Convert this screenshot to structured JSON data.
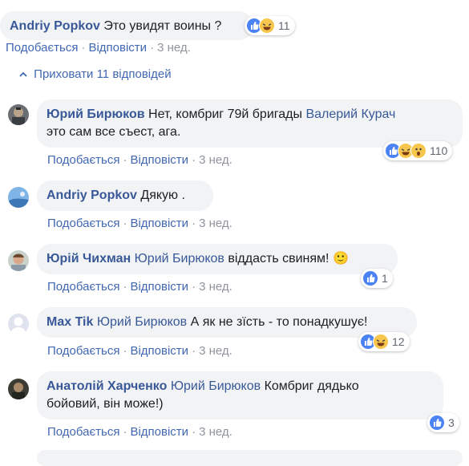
{
  "top_comment": {
    "author": "Andriy Popkov",
    "text": "Это увидят воины ?",
    "reactions_count": "11",
    "actions": {
      "like": "Подобається",
      "reply": "Відповісти",
      "time": "3 нед."
    }
  },
  "hide_replies_label": "Приховати 11 відповідей",
  "replies": [
    {
      "author": "Юрий Бирюков",
      "text_before": "Нет, комбриг 79й бригады",
      "mention": "Валерий Курач",
      "text_after": "это сам все съест, ага.",
      "reactions_count": "110",
      "actions": {
        "like": "Подобається",
        "reply": "Відповісти",
        "time": "3 нед."
      }
    },
    {
      "author": "Andriy Popkov",
      "text": "Дякую .",
      "actions": {
        "like": "Подобається",
        "reply": "Відповісти",
        "time": "3 нед."
      }
    },
    {
      "author": "Юрій Чихман",
      "mention": "Юрий Бирюков",
      "text": "віддасть свиням! 🙂",
      "reactions_count": "1",
      "actions": {
        "like": "Подобається",
        "reply": "Відповісти",
        "time": "3 нед."
      }
    },
    {
      "author": "Max Tik",
      "mention": "Юрий Бирюков",
      "text": "А як не зїсть - то понадкушує!",
      "reactions_count": "12",
      "actions": {
        "like": "Подобається",
        "reply": "Відповісти",
        "time": "3 нед."
      }
    },
    {
      "author": "Анатолій Харченко",
      "mention": "Юрий Бирюков",
      "text_line1": "Комбриг дядько",
      "text_line2": "бойовий, він може!)",
      "reactions_count": "3",
      "actions": {
        "like": "Подобається",
        "reply": "Відповісти",
        "time": "3 нед."
      }
    }
  ],
  "colors": {
    "link": "#385898",
    "action": "#4267b2",
    "bubble": "#f2f3f5",
    "muted": "#90949c"
  }
}
